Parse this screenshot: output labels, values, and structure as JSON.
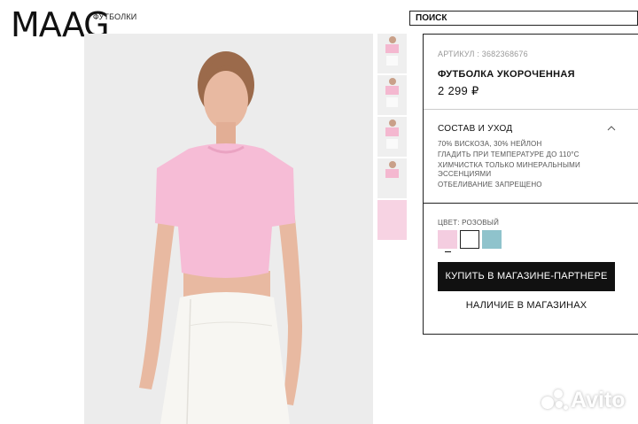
{
  "header": {
    "logo": "MAAG",
    "breadcrumb": "ФУТБОЛКИ",
    "search_placeholder": "ПОИСК"
  },
  "product": {
    "article": "АРТИКУЛ : 3682368676",
    "title": "ФУТБОЛКА УКОРОЧЕННАЯ",
    "price": "2 299 ₽",
    "composition_title": "СОСТАВ И УХОД",
    "composition": [
      "70% ВИСКОЗА, 30% НЕЙЛОН",
      "ГЛАДИТЬ ПРИ ТЕМПЕРАТУРЕ ДО 110°С",
      "ХИМЧИСТКА ТОЛЬКО МИНЕРАЛЬНЫМИ ЭССЕНЦИЯМИ",
      "ОТБЕЛИВАНИЕ ЗАПРЕЩЕНО"
    ],
    "color_label": "ЦВЕТ: РОЗОВЫЙ",
    "swatches": [
      {
        "color": "#f4cde0",
        "selected": true
      },
      {
        "color": "#ffffff",
        "selected": false
      },
      {
        "color": "#8fc3cc",
        "selected": false
      }
    ],
    "buy_button": "КУПИТЬ В МАГАЗИНЕ-ПАРТНЕРЕ",
    "stock_link": "НАЛИЧИЕ В МАГАЗИНАХ"
  },
  "thumbnails_count": 5,
  "watermark": "Avito",
  "colors": {
    "tshirt": "#f6bcd6",
    "skirt": "#f7f6f2",
    "skin": "#e8b9a1",
    "hair": "#9b6a4b",
    "button_bg": "#111111"
  }
}
